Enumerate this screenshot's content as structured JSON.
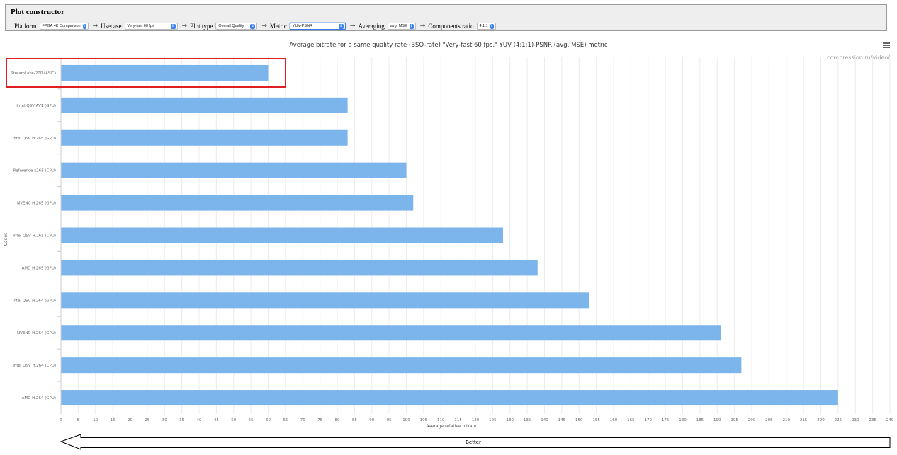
{
  "constructor": {
    "title": "Plot constructor",
    "platform_label": "Platform",
    "platform_value": "FPGA 4K Comparison",
    "usecase_label": "Usecase",
    "usecase_value": "Very-fast 60 fps",
    "plot_type_label": "Plot type",
    "plot_type_value": "Overall Quality",
    "metric_label": "Metric",
    "metric_value": "YUV-PSNR",
    "averaging_label": "Averaging",
    "averaging_value": "avg. MSE",
    "components_ratio_label": "Components ratio",
    "components_ratio_value": "4:1:1",
    "separator": "⇒"
  },
  "credits": "compression.ru/video/",
  "better_label": "Better",
  "highlight_color": "#e02020",
  "chart_data": {
    "type": "bar",
    "orientation": "horizontal",
    "title": "Average bitrate for a same quality rate (BSQ-rate) \"Very-fast 60 fps,\" YUV (4:1:1)-PSNR (avg. MSE) metric",
    "xlabel": "Average relative bitrate",
    "ylabel": "Codec",
    "xlim": [
      0,
      240
    ],
    "xtick_step": 5,
    "grid": true,
    "bar_color": "#7cb5ec",
    "categories": [
      "StreamLake-200 (ASIC)",
      "Intel QSV AV1 (GPU)",
      "Intel QSV H.265 (GPU)",
      "Reference x265 (CPU)",
      "NVENC H.265 (GPU)",
      "Intel QSV H.265 (CPU)",
      "AMD H.265 (GPU)",
      "Intel QSV H.264 (GPU)",
      "NVENC H.264 (GPU)",
      "Intel QSV H.264 (CPU)",
      "AMD H.264 (GPU)"
    ],
    "values": [
      60,
      83,
      83,
      100,
      102,
      128,
      138,
      153,
      191,
      197,
      225
    ],
    "highlighted_category": "StreamLake-200 (ASIC)"
  }
}
